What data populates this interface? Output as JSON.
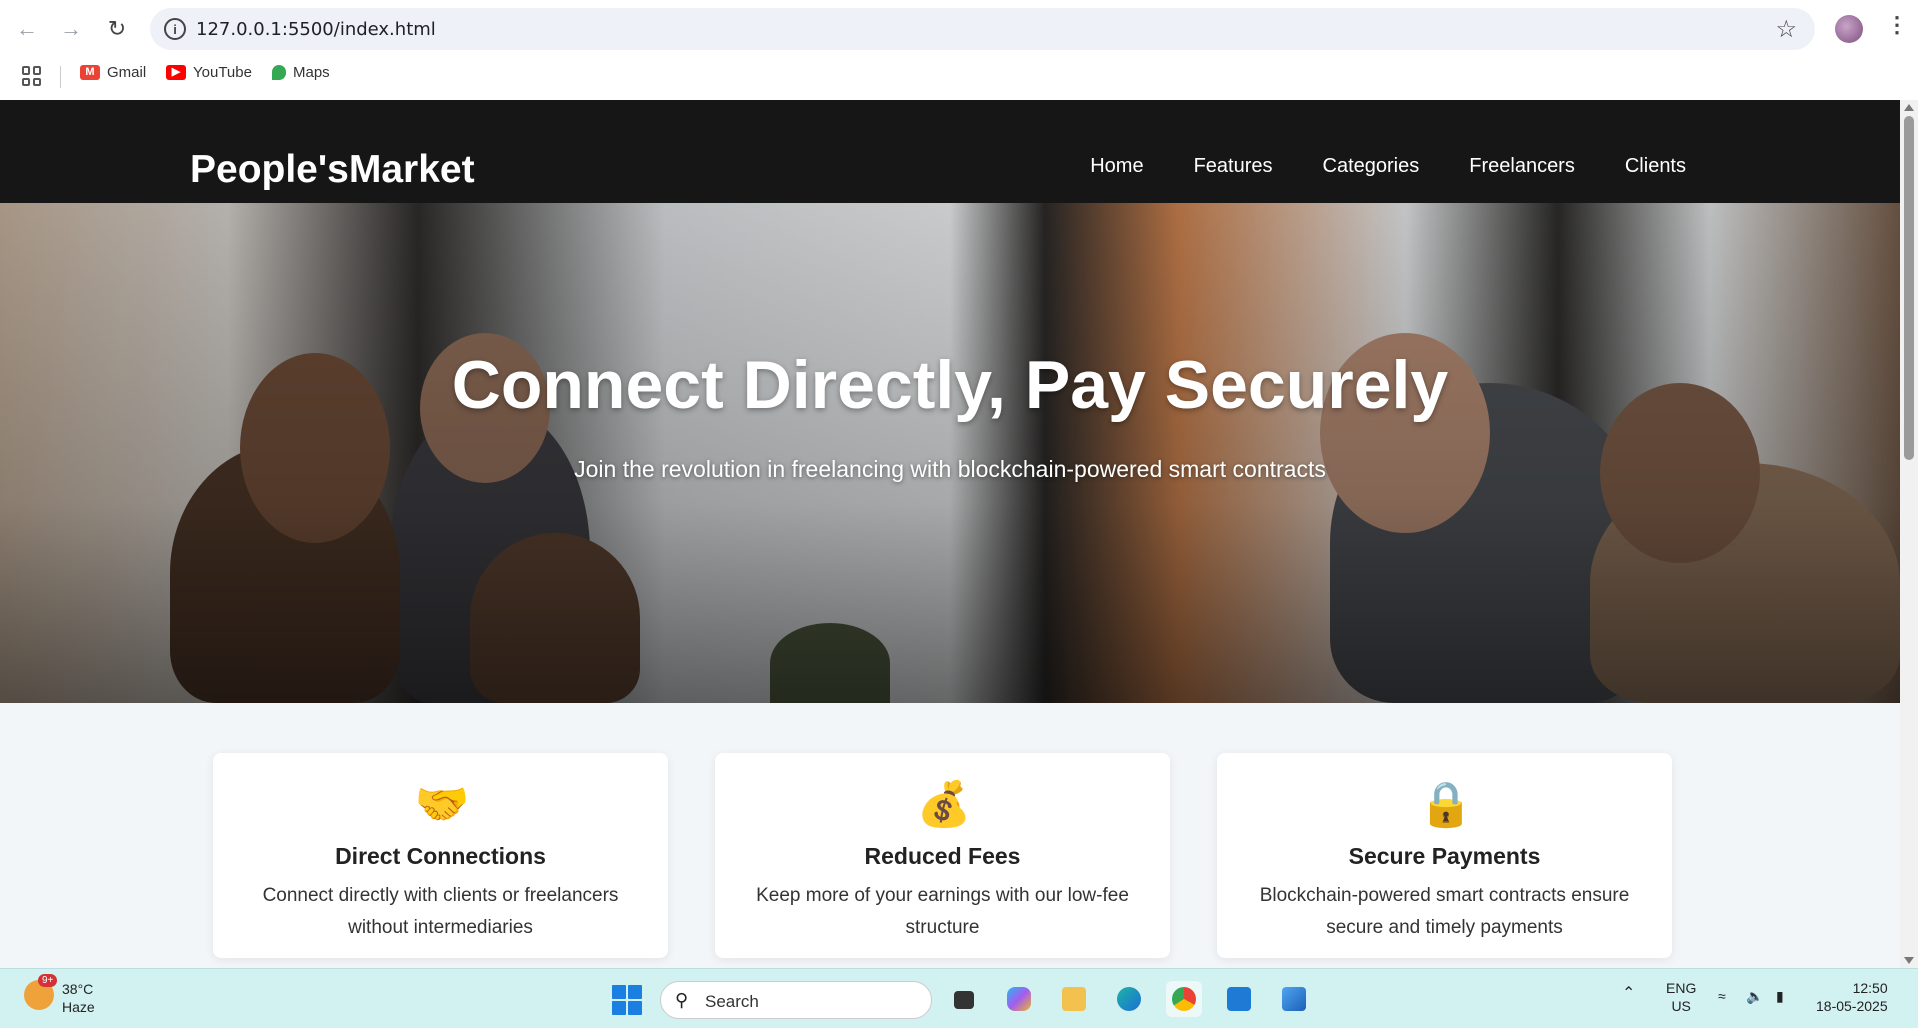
{
  "browser": {
    "url": "127.0.0.1:5500/index.html",
    "bookmarks": [
      {
        "label": "Gmail",
        "icon": "gmail-icon"
      },
      {
        "label": "YouTube",
        "icon": "youtube-icon"
      },
      {
        "label": "Maps",
        "icon": "maps-icon"
      }
    ]
  },
  "site": {
    "logo": "People'sMarket",
    "nav": [
      "Home",
      "Features",
      "Categories",
      "Freelancers",
      "Clients"
    ],
    "hero": {
      "title": "Connect Directly, Pay Securely",
      "subtitle": "Join the revolution in freelancing with blockchain-powered smart contracts"
    },
    "features": [
      {
        "emoji": "🤝",
        "title": "Direct Connections",
        "text": "Connect directly with clients or freelancers without intermediaries"
      },
      {
        "emoji": "💰",
        "title": "Reduced Fees",
        "text": "Keep more of your earnings with our low-fee structure"
      },
      {
        "emoji": "🔒",
        "title": "Secure Payments",
        "text": "Blockchain-powered smart contracts ensure secure and timely payments"
      }
    ]
  },
  "taskbar": {
    "weather": {
      "temp": "38°C",
      "condition": "Haze",
      "badge": "9+"
    },
    "search_label": "Search",
    "language": {
      "line1": "ENG",
      "line2": "US"
    },
    "time": "12:50",
    "date": "18-05-2025"
  },
  "colors": {
    "header_bg": "#161616",
    "page_bg": "#f3f6f9",
    "taskbar_bg": "#d2f1f1"
  }
}
